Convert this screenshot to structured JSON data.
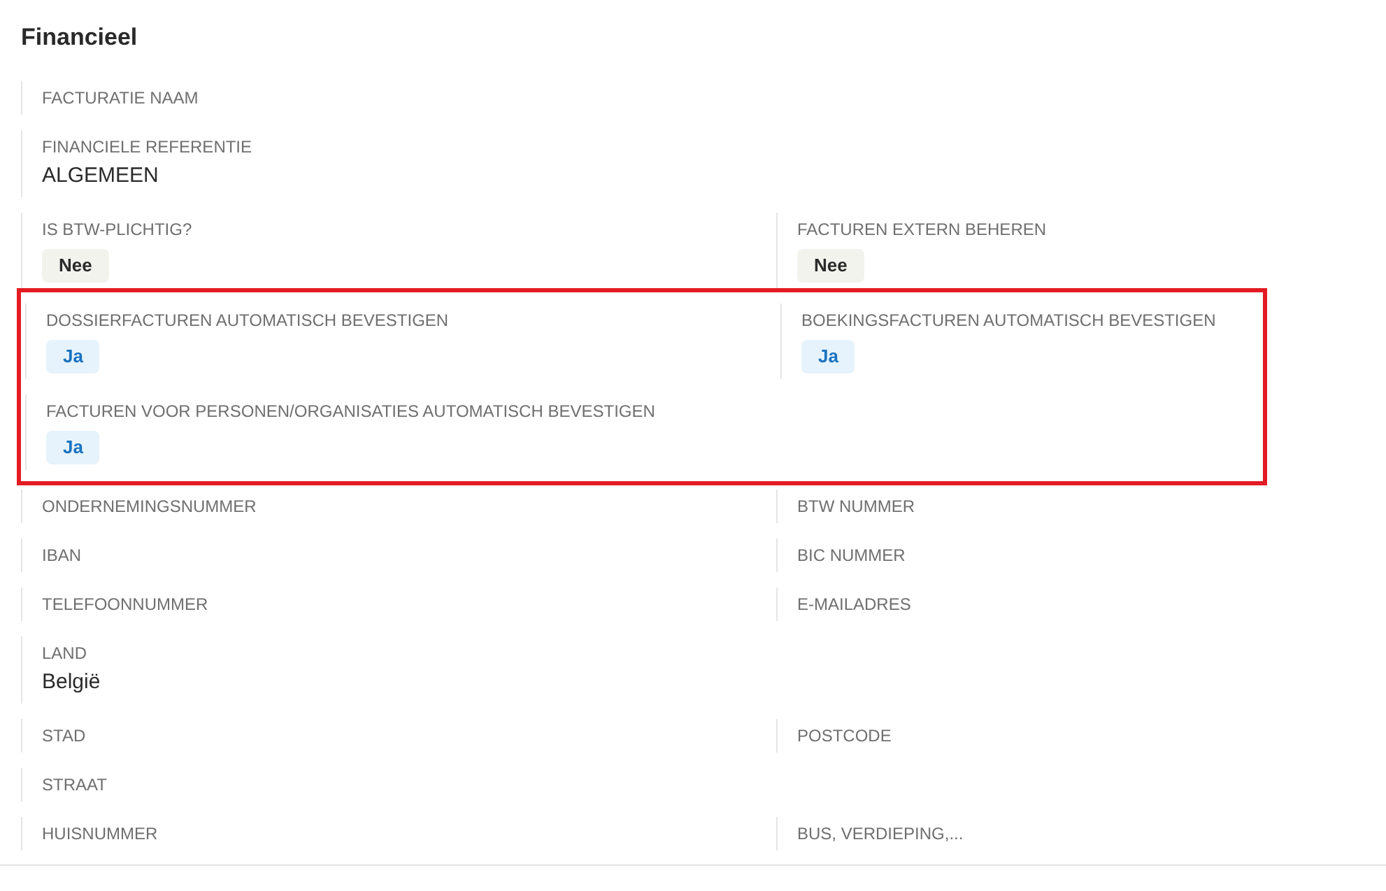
{
  "title": "Financieel",
  "groups": [
    {
      "highlighted": false,
      "rows": [
        [
          {
            "label": "FACTURATIE NAAM"
          }
        ],
        [
          {
            "label": "FINANCIELE REFERENTIE",
            "value": {
              "kind": "text",
              "text": "ALGEMEEN"
            }
          }
        ],
        [
          {
            "label": "IS BTW-PLICHTIG?",
            "value": {
              "kind": "neutral",
              "text": "Nee"
            }
          },
          {
            "label": "FACTUREN EXTERN BEHEREN",
            "value": {
              "kind": "neutral",
              "text": "Nee"
            }
          }
        ]
      ]
    },
    {
      "highlighted": true,
      "rows": [
        [
          {
            "label": "DOSSIERFACTUREN AUTOMATISCH BEVESTIGEN",
            "value": {
              "kind": "info",
              "text": "Ja"
            }
          },
          {
            "label": "BOEKINGSFACTUREN AUTOMATISCH BEVESTIGEN",
            "value": {
              "kind": "info",
              "text": "Ja"
            }
          }
        ],
        [
          {
            "label": "FACTUREN VOOR PERSONEN/ORGANISATIES AUTOMATISCH BEVESTIGEN",
            "value": {
              "kind": "info",
              "text": "Ja"
            }
          }
        ]
      ]
    },
    {
      "highlighted": false,
      "rows": [
        [
          {
            "label": "ONDERNEMINGSNUMMER"
          },
          {
            "label": "BTW NUMMER"
          }
        ],
        [
          {
            "label": "IBAN"
          },
          {
            "label": "BIC NUMMER"
          }
        ],
        [
          {
            "label": "TELEFOONNUMMER"
          },
          {
            "label": "E-MAILADRES"
          }
        ],
        [
          {
            "label": "LAND",
            "value": {
              "kind": "text",
              "text": "België"
            }
          }
        ],
        [
          {
            "label": "STAD"
          },
          {
            "label": "POSTCODE"
          }
        ],
        [
          {
            "label": "STRAAT"
          }
        ],
        [
          {
            "label": "HUISNUMMER"
          },
          {
            "label": "BUS, VERDIEPING,..."
          }
        ]
      ]
    }
  ]
}
